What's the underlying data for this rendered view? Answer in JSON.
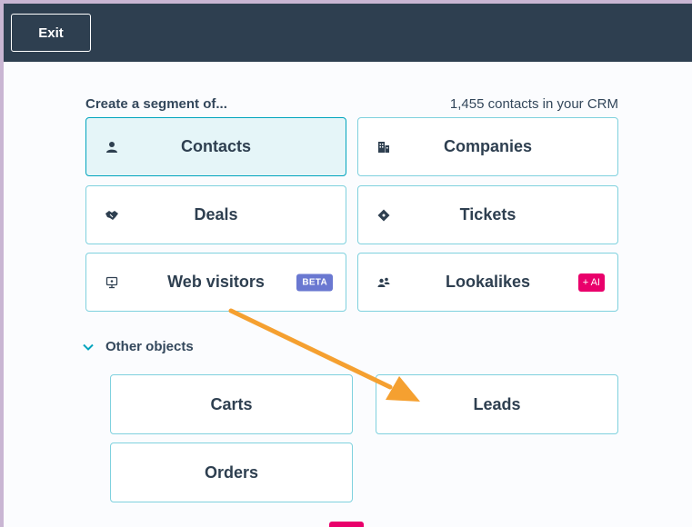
{
  "header": {
    "exit_label": "Exit"
  },
  "segment": {
    "prompt": "Create a segment of...",
    "crm_count": "1,455 contacts in your CRM",
    "cards": [
      {
        "label": "Contacts",
        "icon": "contact-icon",
        "selected": true
      },
      {
        "label": "Companies",
        "icon": "building-icon"
      },
      {
        "label": "Deals",
        "icon": "handshake-icon"
      },
      {
        "label": "Tickets",
        "icon": "ticket-icon"
      },
      {
        "label": "Web visitors",
        "icon": "monitor-icon",
        "badge": "BETA"
      },
      {
        "label": "Lookalikes",
        "icon": "people-icon",
        "badge": "+ AI"
      }
    ]
  },
  "other_objects": {
    "label": "Other objects",
    "cards": [
      {
        "label": "Carts"
      },
      {
        "label": "Leads"
      },
      {
        "label": "Orders"
      }
    ]
  },
  "colors": {
    "topbar": "#2e3f50",
    "card_border": "#7fd1de",
    "card_selected_bg": "#e5f5f8",
    "beta_badge": "#6a78d1",
    "ai_badge": "#e9006b",
    "annotation_arrow": "#f5a030"
  }
}
